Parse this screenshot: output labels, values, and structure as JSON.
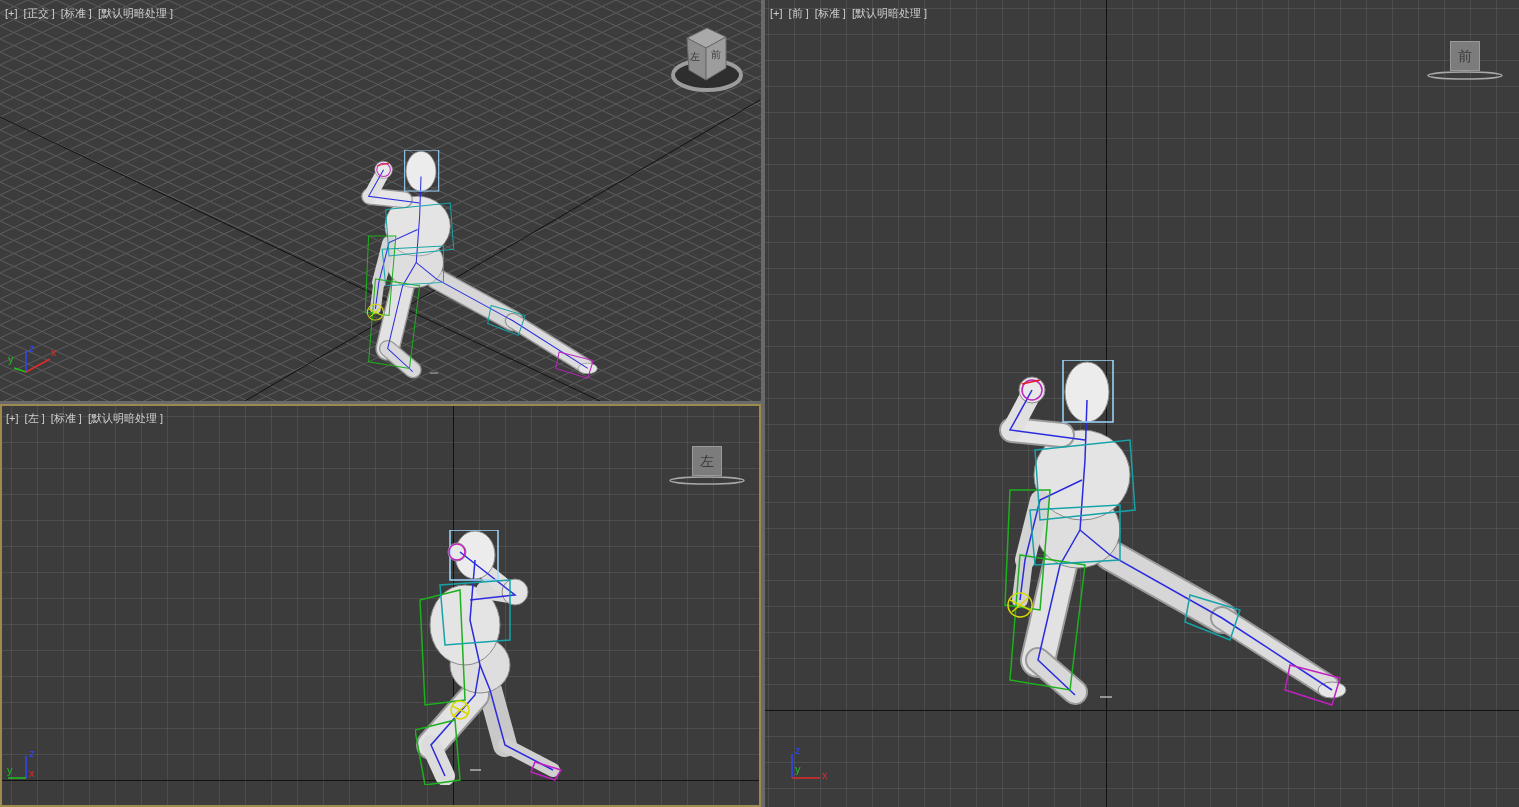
{
  "viewports": [
    {
      "kind": "perspective",
      "active": false,
      "labels": [
        "[+]",
        "[正交 ]",
        "[标准 ]",
        "[默认明暗处理 ]"
      ],
      "viewcube": {
        "kind": "cube",
        "faces": [
          "左",
          "前"
        ]
      },
      "gizmo": {
        "axes": [
          "z",
          "x",
          "y"
        ]
      }
    },
    {
      "kind": "left",
      "active": true,
      "labels": [
        "[+]",
        "[左 ]",
        "[标准 ]",
        "[默认明暗处理 ]"
      ],
      "viewcube": {
        "kind": "tile",
        "faces": [
          "左"
        ]
      },
      "gizmo": {
        "axes": [
          "z",
          "y",
          "x"
        ]
      }
    },
    {
      "kind": "front",
      "active": false,
      "labels": [
        "[+]",
        "[前 ]",
        "[标准 ]",
        "[默认明暗处理 ]"
      ],
      "viewcube": {
        "kind": "tile",
        "faces": [
          "前"
        ]
      },
      "gizmo": {
        "axes": [
          "z",
          "y",
          "x"
        ]
      }
    }
  ]
}
